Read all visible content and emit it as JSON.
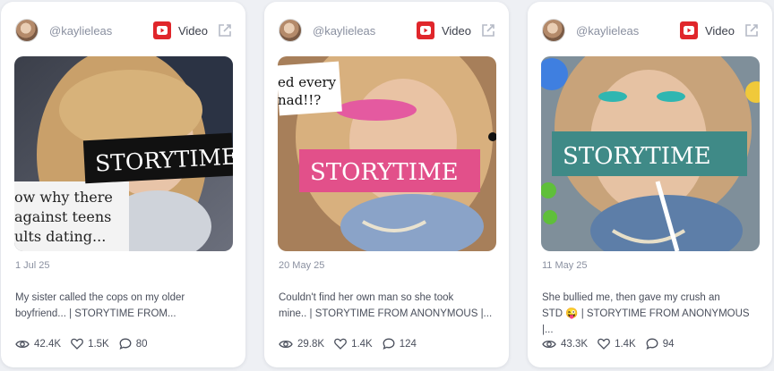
{
  "posts": [
    {
      "handle": "@kaylieleas",
      "type_label": "Video",
      "date": "1 Jul 25",
      "caption_line1": "My sister called the cops on my older",
      "caption_line2": "boyfriend... | STORYTIME FROM...",
      "views": "42.4K",
      "likes": "1.5K",
      "comments": "80",
      "thumb_banner": "STORYTIME",
      "thumb_text_1": "ow why there",
      "thumb_text_2": "against teens",
      "thumb_text_3": "ults dating..."
    },
    {
      "handle": "@kaylieleas",
      "type_label": "Video",
      "date": "20 May 25",
      "caption_line1": "Couldn't find her own man so she took",
      "caption_line2": "mine.. | STORYTIME FROM ANONYMOUS |...",
      "views": "29.8K",
      "likes": "1.4K",
      "comments": "124",
      "thumb_banner": "STORYTIME",
      "thumb_text_1": "ed every",
      "thumb_text_2": "nad!!?"
    },
    {
      "handle": "@kaylieleas",
      "type_label": "Video",
      "date": "11 May 25",
      "caption_line1": "She bullied me, then gave my crush an",
      "caption_line2": "STD 😜 | STORYTIME FROM ANONYMOUS |...",
      "views": "43.3K",
      "likes": "1.4K",
      "comments": "94",
      "thumb_banner": "STORYTIME"
    }
  ],
  "colors": {
    "youtube_red": "#e0262b",
    "banner_black": "#111111",
    "banner_pink": "#e2508a",
    "banner_teal": "#3f8a87"
  },
  "icons": {
    "platform": "youtube-icon",
    "external": "external-link-icon",
    "views": "eye-icon",
    "likes": "heart-icon",
    "comments": "comment-icon"
  }
}
